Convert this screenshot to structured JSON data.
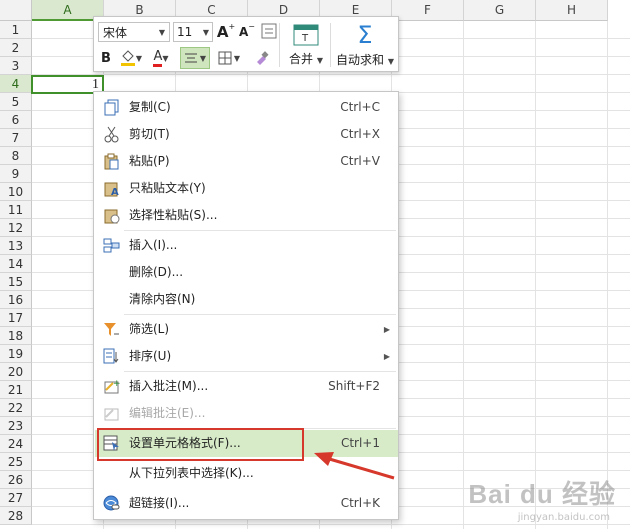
{
  "sheet": {
    "columns": [
      "A",
      "B",
      "C",
      "D",
      "E",
      "F",
      "G",
      "H"
    ],
    "rows": [
      "1",
      "2",
      "3",
      "4",
      "5",
      "6",
      "7",
      "8",
      "9",
      "10",
      "11",
      "12",
      "13",
      "14",
      "15",
      "16",
      "17",
      "18",
      "19",
      "20",
      "21",
      "22",
      "23",
      "24",
      "25",
      "26",
      "27",
      "28"
    ],
    "selected_column": "A",
    "selected_row": "4",
    "cell_value": "1"
  },
  "mini_toolbar": {
    "font_name": "宋体",
    "font_size": "11",
    "bold_label": "B",
    "font_color_label": "A",
    "grow_font_label": "A",
    "shrink_font_label": "A",
    "merge_label": "合并",
    "autosum_label": "自动求和",
    "accent_fill": "#f2c400",
    "accent_font": "#e02020"
  },
  "context_menu": {
    "items": [
      {
        "label": "复制(C)",
        "shortcut": "Ctrl+C",
        "icon": "copy-icon"
      },
      {
        "label": "剪切(T)",
        "shortcut": "Ctrl+X",
        "icon": "scissors-icon"
      },
      {
        "label": "粘贴(P)",
        "shortcut": "Ctrl+V",
        "icon": "paste-icon"
      },
      {
        "label": "只粘贴文本(Y)",
        "shortcut": "",
        "icon": "paste-text-icon"
      },
      {
        "label": "选择性粘贴(S)...",
        "shortcut": "",
        "icon": "paste-special-icon"
      },
      {
        "label": "插入(I)...",
        "shortcut": "",
        "icon": "insert-icon"
      },
      {
        "label": "删除(D)...",
        "shortcut": "",
        "icon": ""
      },
      {
        "label": "清除内容(N)",
        "shortcut": "",
        "icon": ""
      },
      {
        "label": "筛选(L)",
        "shortcut": "",
        "icon": "filter-icon"
      },
      {
        "label": "排序(U)",
        "shortcut": "",
        "icon": "sort-icon"
      },
      {
        "label": "插入批注(M)...",
        "shortcut": "Shift+F2",
        "icon": "insert-comment-icon"
      },
      {
        "label": "编辑批注(E)...",
        "shortcut": "",
        "icon": "edit-comment-icon"
      },
      {
        "label": "设置单元格格式(F)...",
        "shortcut": "Ctrl+1",
        "icon": "format-cells-icon"
      },
      {
        "label": "从下拉列表中选择(K)...",
        "shortcut": "",
        "icon": ""
      },
      {
        "label": "超链接(I)...",
        "shortcut": "Ctrl+K",
        "icon": "hyperlink-icon"
      }
    ],
    "highlight_color": "#d7ebc9",
    "annotation_color": "#d6382b"
  },
  "watermark": {
    "text": "Bai du 经验",
    "sub": "jingyan.baidu.com"
  }
}
